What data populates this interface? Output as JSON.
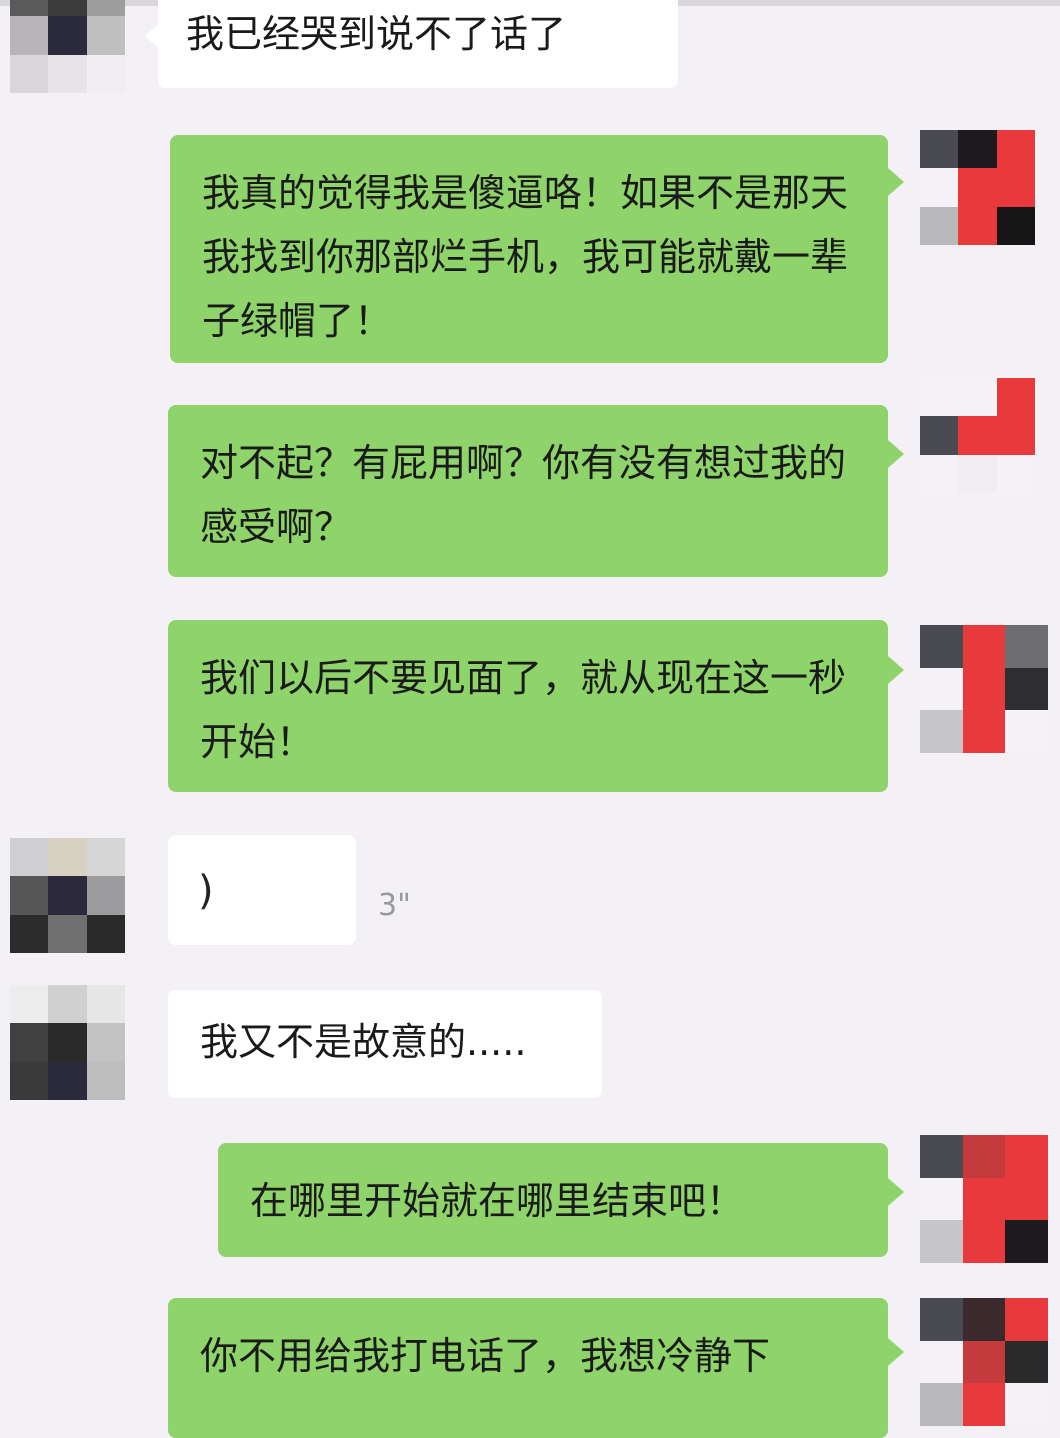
{
  "conversation": {
    "messages": [
      {
        "side": "left",
        "text": "我已经哭到说不了话了"
      },
      {
        "side": "right",
        "text": "我真的觉得我是傻逼咯！如果不是那天我找到你那部烂手机，我可能就戴一辈子绿帽了！"
      },
      {
        "side": "right",
        "text": "对不起？有屁用啊？你有没有想过我的感受啊？"
      },
      {
        "side": "right",
        "text": "我们以后不要见面了，就从现在这一秒开始！"
      },
      {
        "side": "left",
        "type": "voice",
        "glyph": ")",
        "duration": "3\""
      },
      {
        "side": "left",
        "text": "我又不是故意的....."
      },
      {
        "side": "right",
        "text": "在哪里开始就在哪里结束吧！"
      },
      {
        "side": "right",
        "text": "你不用给我打电话了，我想冷静下"
      }
    ]
  },
  "colors": {
    "background": "#f3f1f6",
    "incoming_bubble": "#ffffff",
    "outgoing_bubble": "#8fd46a",
    "avatar_red": "#e8393c"
  },
  "icons": {
    "voice": "voice-wave-icon"
  }
}
